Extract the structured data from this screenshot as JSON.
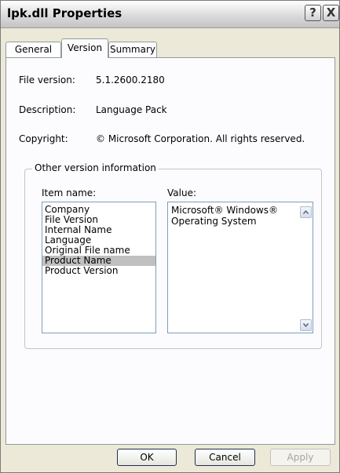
{
  "window": {
    "title": "lpk.dll Properties",
    "help_button": "?",
    "close_button": "X"
  },
  "tabs": [
    {
      "label": "General",
      "active": false
    },
    {
      "label": "Version",
      "active": true
    },
    {
      "label": "Summary",
      "active": false
    }
  ],
  "version_info": {
    "file_version_label": "File version:",
    "file_version_value": "5.1.2600.2180",
    "description_label": "Description:",
    "description_value": "Language Pack",
    "copyright_label": "Copyright:",
    "copyright_value": "© Microsoft Corporation. All rights reserved."
  },
  "other_info": {
    "group_title": "Other version information",
    "item_name_header": "Item name:",
    "value_header": "Value:",
    "items": [
      "Company",
      "File Version",
      "Internal Name",
      "Language",
      "Original File name",
      "Product Name",
      "Product Version"
    ],
    "selected_index": 5,
    "value_text": "Microsoft® Windows® Operating System"
  },
  "buttons": {
    "ok": "OK",
    "cancel": "Cancel",
    "apply": "Apply"
  }
}
